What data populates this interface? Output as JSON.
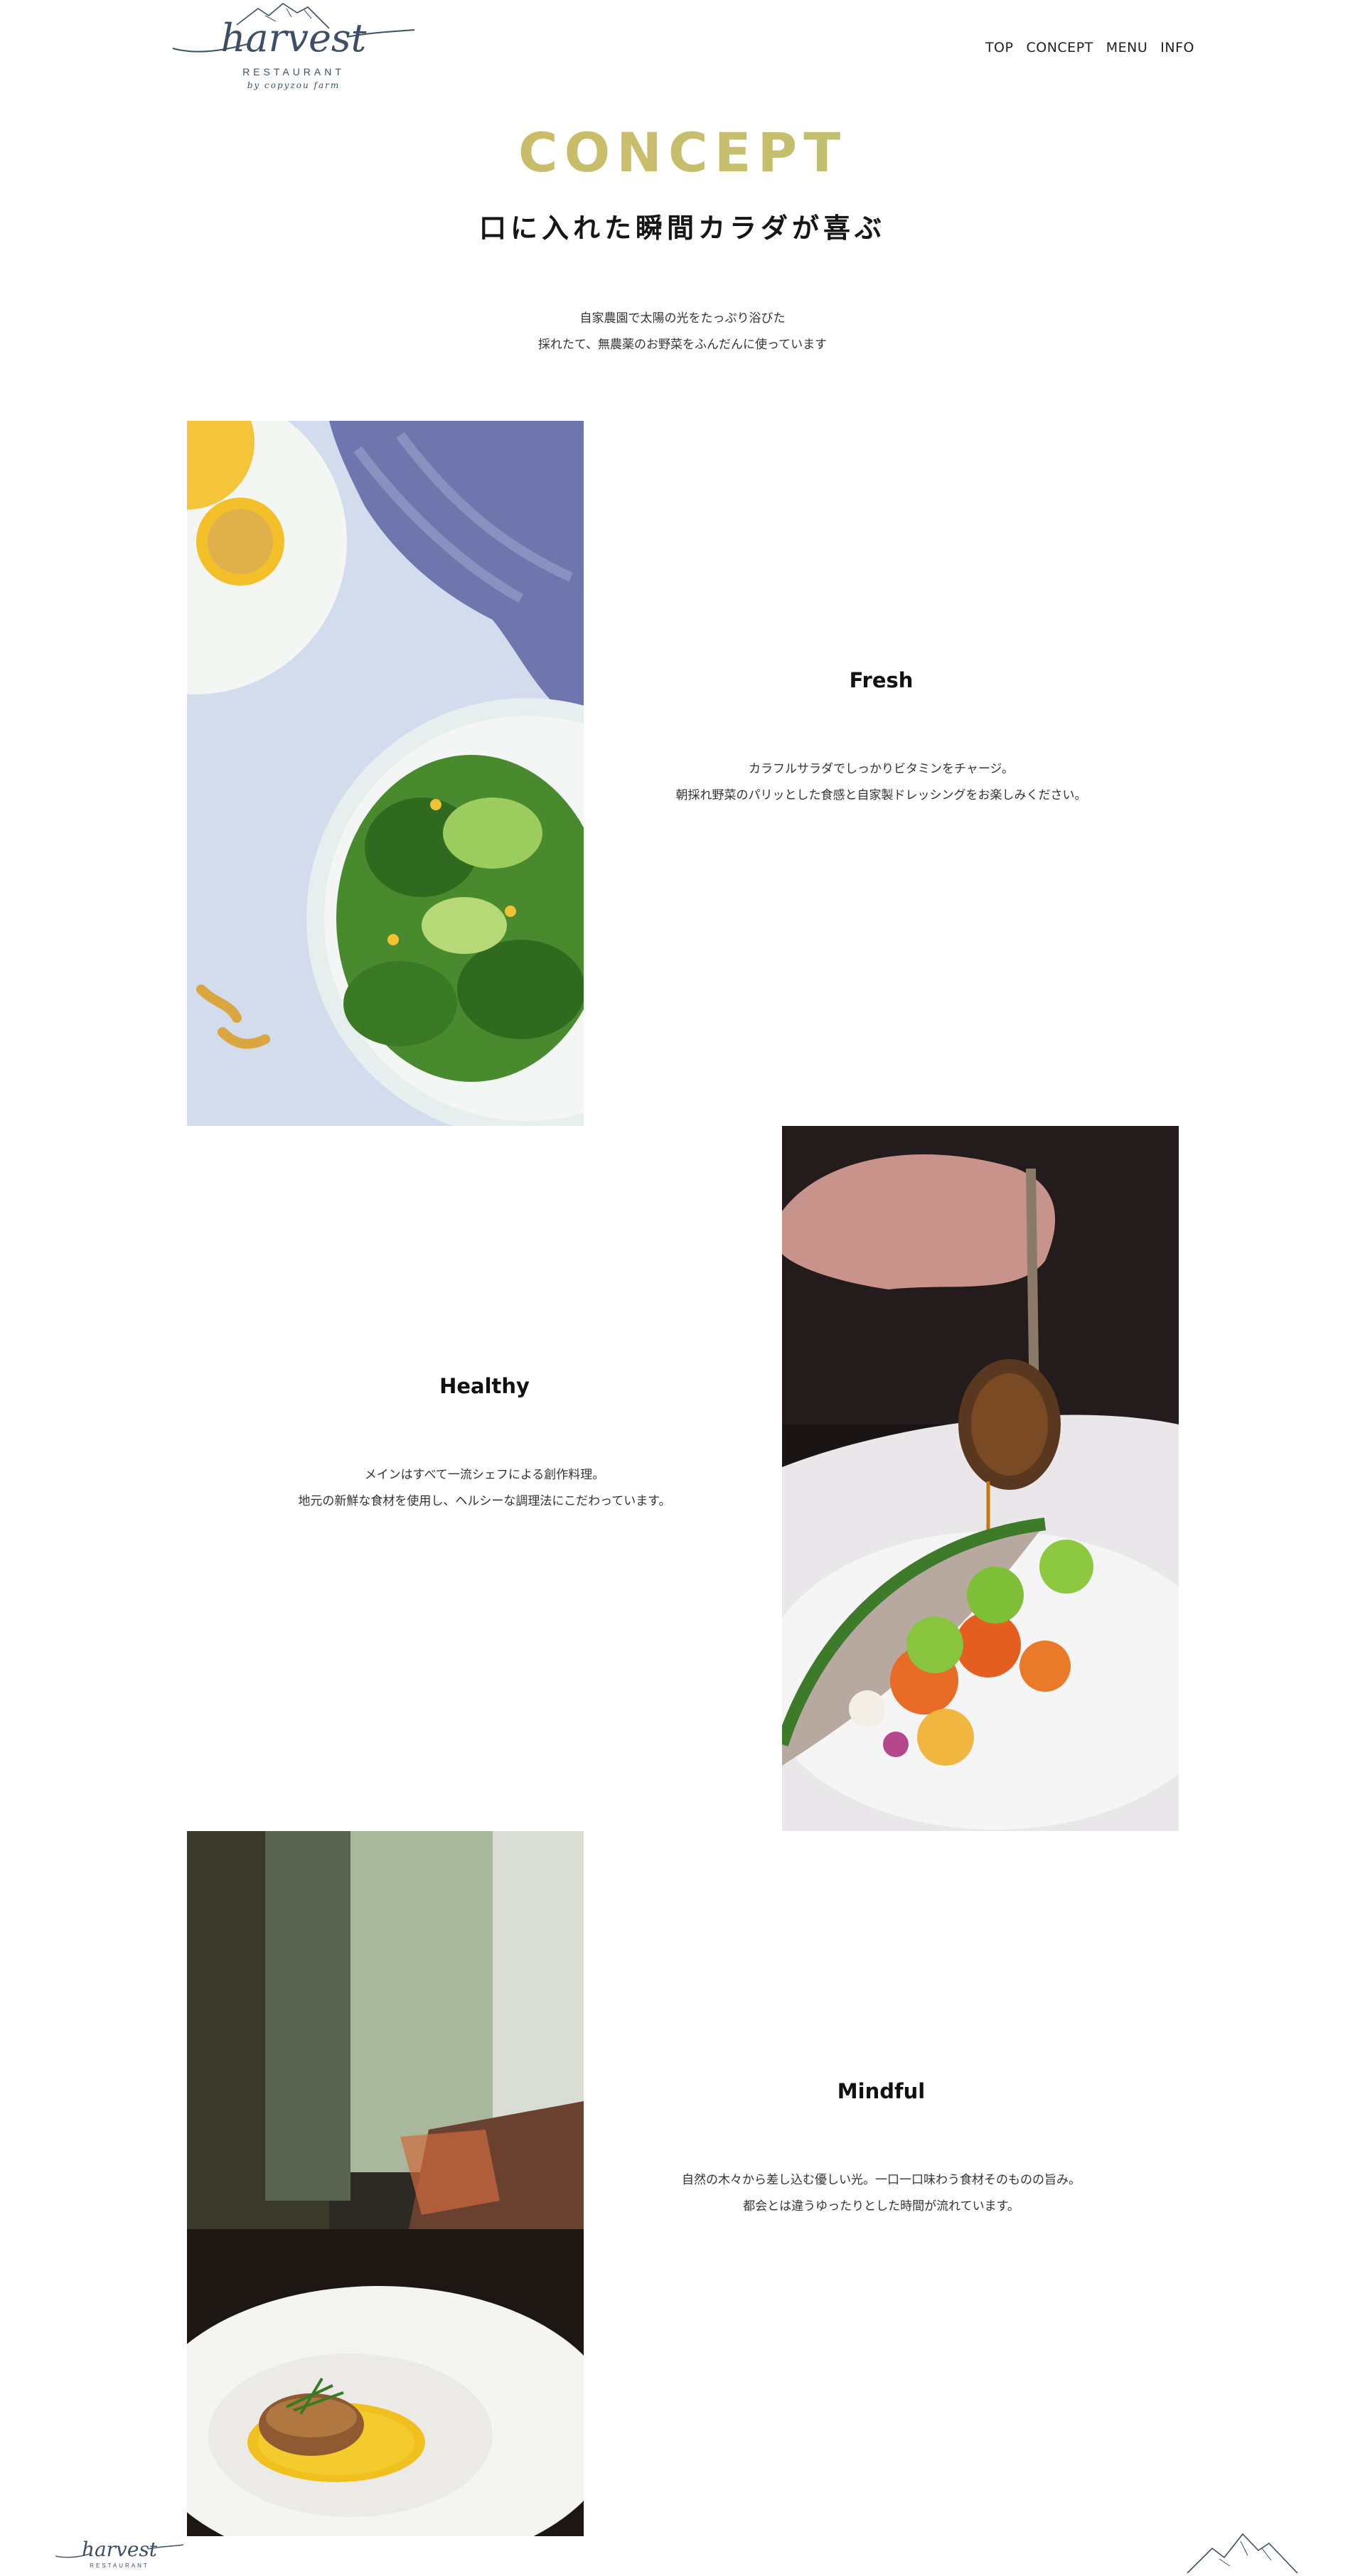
{
  "header": {
    "logo": {
      "script": "harvest",
      "word": "RESTAURANT",
      "tagline": "by copyzou farm"
    },
    "nav": [
      "TOP",
      "CONCEPT",
      "MENU",
      "INFO"
    ]
  },
  "concept": {
    "title": "CONCEPT",
    "subtitle": "口に入れた瞬間カラダが喜ぶ",
    "intro": [
      "自家農園で太陽の光をたっぷり浴びた",
      "採れたて、無農薬のお野菜をふんだんに使っています"
    ]
  },
  "features": [
    {
      "title": "Fresh",
      "lines": [
        "カラフルサラダでしっかりビタミンをチャージ。",
        "朝採れ野菜のパリッとした食感と自家製ドレッシングをお楽しみください。"
      ]
    },
    {
      "title": "Healthy",
      "lines": [
        "メインはすべて一流シェフによる創作料理。",
        "地元の新鮮な食材を使用し、ヘルシーな調理法にこだわっています。"
      ]
    },
    {
      "title": "Mindful",
      "lines": [
        "自然の木々から差し込む優しい光。一口一口味わう食材そのものの旨み。",
        "都会とは違うゆったりとした時間が流れています。"
      ]
    }
  ],
  "colors": {
    "brand_navy": "#3c4f66",
    "gold": "#d2b766",
    "green": "#a4bd76"
  },
  "icons": [
    "mountain-icon"
  ]
}
